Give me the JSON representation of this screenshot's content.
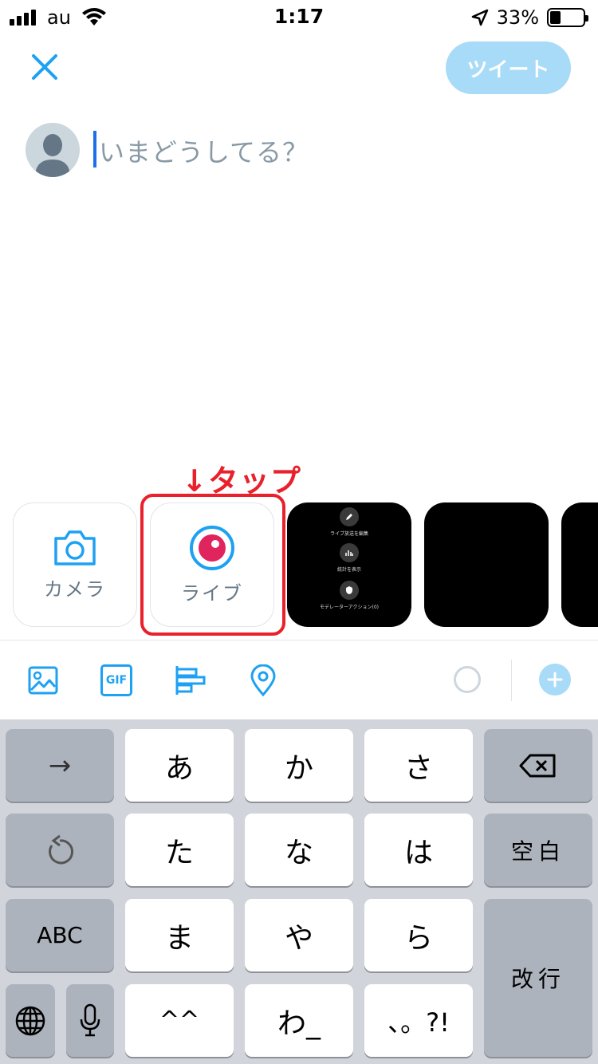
{
  "status_bar": {
    "carrier": "au",
    "time": "1:17",
    "battery": "33%",
    "battery_level": 0.33,
    "icons": [
      "signal-icon",
      "wifi-icon",
      "location-arrow-icon",
      "battery-icon"
    ]
  },
  "compose": {
    "tweet_button": "ツイート",
    "placeholder": "いまどうしてる？",
    "annotation": "↓タップ"
  },
  "media_tiles": {
    "camera_label": "カメラ",
    "live_label": "ライブ",
    "thumb_options": [
      "ライブ放送を編集",
      "統計を表示",
      "モデレーターアクション(0)"
    ]
  },
  "toolbar": {
    "icons": [
      "image-icon",
      "gif-icon",
      "poll-icon",
      "location-pin-icon",
      "character-counter-icon",
      "add-tweet-icon"
    ],
    "gif_text": "GIF"
  },
  "keyboard": {
    "arrow": "→",
    "k_a": "あ",
    "k_ka": "か",
    "k_sa": "さ",
    "k_ta": "た",
    "k_na": "な",
    "k_ha": "は",
    "k_ma": "ま",
    "k_ya": "や",
    "k_ra": "ら",
    "k_face": "^^",
    "k_wa": "わ_",
    "k_punct": "、。?!",
    "abc": "ABC",
    "space": "空白",
    "enter": "改行"
  },
  "colors": {
    "accent": "#1da1f2",
    "tweet_disabled": "#a8dbf7",
    "live_red": "#e0245e",
    "annotation_red": "#e8212c"
  }
}
